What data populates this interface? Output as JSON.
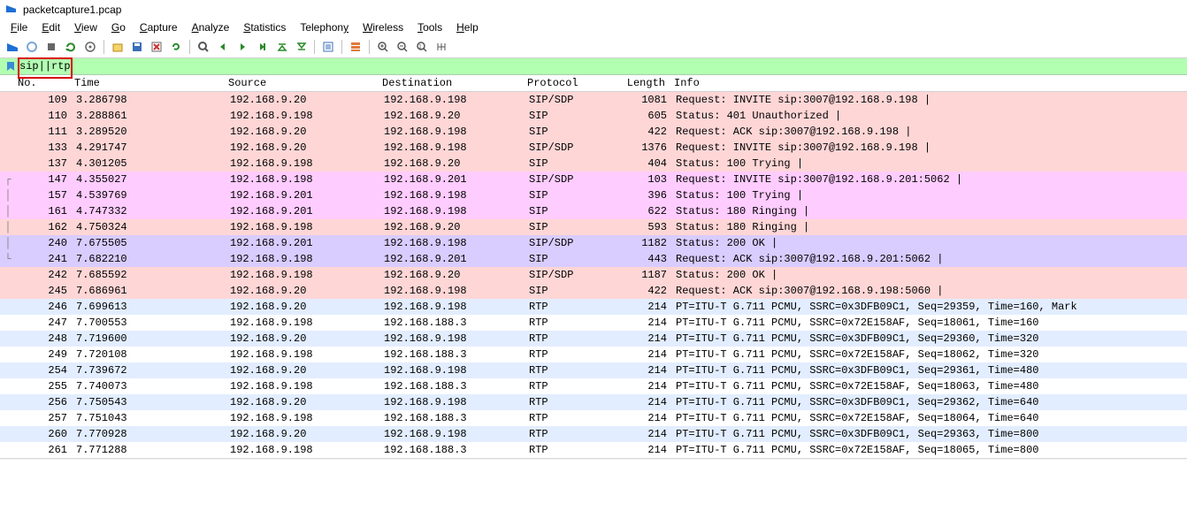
{
  "window": {
    "title": "packetcapture1.pcap"
  },
  "menu": {
    "file": {
      "u": "F",
      "rest": "ile"
    },
    "edit": {
      "u": "E",
      "rest": "dit"
    },
    "view": {
      "u": "V",
      "rest": "iew"
    },
    "go": {
      "u": "G",
      "rest": "o"
    },
    "capture": {
      "u": "C",
      "rest": "apture"
    },
    "analyze": {
      "u": "A",
      "rest": "nalyze"
    },
    "statistics": {
      "u": "S",
      "rest": "tatistics"
    },
    "telephony": {
      "u": "T",
      "rest": "elephony"
    },
    "wireless": {
      "u": "W",
      "rest": "ireless"
    },
    "tools": {
      "u": "T",
      "rest": "ools"
    },
    "help": {
      "u": "H",
      "rest": "elp"
    }
  },
  "filter": {
    "value": "sip||rtp"
  },
  "columns": {
    "no": "No.",
    "time": "Time",
    "src": "Source",
    "dst": "Destination",
    "proto": "Protocol",
    "len": "Length",
    "info": "Info"
  },
  "rows": [
    {
      "no": "109",
      "time": "3.286798",
      "src": "192.168.9.20",
      "dst": "192.168.9.198",
      "proto": "SIP/SDP",
      "len": "1081",
      "info": "Request: INVITE sip:3007@192.168.9.198 | ",
      "cls": "r-pink",
      "g": ""
    },
    {
      "no": "110",
      "time": "3.288861",
      "src": "192.168.9.198",
      "dst": "192.168.9.20",
      "proto": "SIP",
      "len": "605",
      "info": "Status: 401 Unauthorized | ",
      "cls": "r-pink",
      "g": ""
    },
    {
      "no": "111",
      "time": "3.289520",
      "src": "192.168.9.20",
      "dst": "192.168.9.198",
      "proto": "SIP",
      "len": "422",
      "info": "Request: ACK sip:3007@192.168.9.198 | ",
      "cls": "r-pink",
      "g": ""
    },
    {
      "no": "133",
      "time": "4.291747",
      "src": "192.168.9.20",
      "dst": "192.168.9.198",
      "proto": "SIP/SDP",
      "len": "1376",
      "info": "Request: INVITE sip:3007@192.168.9.198 | ",
      "cls": "r-pink",
      "g": ""
    },
    {
      "no": "137",
      "time": "4.301205",
      "src": "192.168.9.198",
      "dst": "192.168.9.20",
      "proto": "SIP",
      "len": "404",
      "info": "Status: 100 Trying | ",
      "cls": "r-pink",
      "g": ""
    },
    {
      "no": "147",
      "time": "4.355027",
      "src": "192.168.9.198",
      "dst": "192.168.9.201",
      "proto": "SIP/SDP",
      "len": "103",
      "info": "Request: INVITE sip:3007@192.168.9.201:5062 | ",
      "cls": "r-magenta",
      "g": "┌"
    },
    {
      "no": "157",
      "time": "4.539769",
      "src": "192.168.9.201",
      "dst": "192.168.9.198",
      "proto": "SIP",
      "len": "396",
      "info": "Status: 100 Trying | ",
      "cls": "r-magenta",
      "g": "│"
    },
    {
      "no": "161",
      "time": "4.747332",
      "src": "192.168.9.201",
      "dst": "192.168.9.198",
      "proto": "SIP",
      "len": "622",
      "info": "Status: 180 Ringing | ",
      "cls": "r-magenta",
      "g": "│"
    },
    {
      "no": "162",
      "time": "4.750324",
      "src": "192.168.9.198",
      "dst": "192.168.9.20",
      "proto": "SIP",
      "len": "593",
      "info": "Status: 180 Ringing | ",
      "cls": "r-pink",
      "g": "│"
    },
    {
      "no": "240",
      "time": "7.675505",
      "src": "192.168.9.201",
      "dst": "192.168.9.198",
      "proto": "SIP/SDP",
      "len": "1182",
      "info": "Status: 200 OK | ",
      "cls": "r-purple",
      "g": "│"
    },
    {
      "no": "241",
      "time": "7.682210",
      "src": "192.168.9.198",
      "dst": "192.168.9.201",
      "proto": "SIP",
      "len": "443",
      "info": "Request: ACK sip:3007@192.168.9.201:5062 | ",
      "cls": "r-purple",
      "g": "└"
    },
    {
      "no": "242",
      "time": "7.685592",
      "src": "192.168.9.198",
      "dst": "192.168.9.20",
      "proto": "SIP/SDP",
      "len": "1187",
      "info": "Status: 200 OK | ",
      "cls": "r-pink",
      "g": ""
    },
    {
      "no": "245",
      "time": "7.686961",
      "src": "192.168.9.20",
      "dst": "192.168.9.198",
      "proto": "SIP",
      "len": "422",
      "info": "Request: ACK sip:3007@192.168.9.198:5060 | ",
      "cls": "r-pink",
      "g": ""
    },
    {
      "no": "246",
      "time": "7.699613",
      "src": "192.168.9.20",
      "dst": "192.168.9.198",
      "proto": "RTP",
      "len": "214",
      "info": "PT=ITU-T G.711 PCMU, SSRC=0x3DFB09C1, Seq=29359, Time=160, Mark",
      "cls": "r-blue",
      "g": ""
    },
    {
      "no": "247",
      "time": "7.700553",
      "src": "192.168.9.198",
      "dst": "192.168.188.3",
      "proto": "RTP",
      "len": "214",
      "info": "PT=ITU-T G.711 PCMU, SSRC=0x72E158AF, Seq=18061, Time=160",
      "cls": "r-white",
      "g": ""
    },
    {
      "no": "248",
      "time": "7.719600",
      "src": "192.168.9.20",
      "dst": "192.168.9.198",
      "proto": "RTP",
      "len": "214",
      "info": "PT=ITU-T G.711 PCMU, SSRC=0x3DFB09C1, Seq=29360, Time=320",
      "cls": "r-blue",
      "g": ""
    },
    {
      "no": "249",
      "time": "7.720108",
      "src": "192.168.9.198",
      "dst": "192.168.188.3",
      "proto": "RTP",
      "len": "214",
      "info": "PT=ITU-T G.711 PCMU, SSRC=0x72E158AF, Seq=18062, Time=320",
      "cls": "r-white",
      "g": ""
    },
    {
      "no": "254",
      "time": "7.739672",
      "src": "192.168.9.20",
      "dst": "192.168.9.198",
      "proto": "RTP",
      "len": "214",
      "info": "PT=ITU-T G.711 PCMU, SSRC=0x3DFB09C1, Seq=29361, Time=480",
      "cls": "r-blue",
      "g": ""
    },
    {
      "no": "255",
      "time": "7.740073",
      "src": "192.168.9.198",
      "dst": "192.168.188.3",
      "proto": "RTP",
      "len": "214",
      "info": "PT=ITU-T G.711 PCMU, SSRC=0x72E158AF, Seq=18063, Time=480",
      "cls": "r-white",
      "g": ""
    },
    {
      "no": "256",
      "time": "7.750543",
      "src": "192.168.9.20",
      "dst": "192.168.9.198",
      "proto": "RTP",
      "len": "214",
      "info": "PT=ITU-T G.711 PCMU, SSRC=0x3DFB09C1, Seq=29362, Time=640",
      "cls": "r-blue",
      "g": ""
    },
    {
      "no": "257",
      "time": "7.751043",
      "src": "192.168.9.198",
      "dst": "192.168.188.3",
      "proto": "RTP",
      "len": "214",
      "info": "PT=ITU-T G.711 PCMU, SSRC=0x72E158AF, Seq=18064, Time=640",
      "cls": "r-white",
      "g": ""
    },
    {
      "no": "260",
      "time": "7.770928",
      "src": "192.168.9.20",
      "dst": "192.168.9.198",
      "proto": "RTP",
      "len": "214",
      "info": "PT=ITU-T G.711 PCMU, SSRC=0x3DFB09C1, Seq=29363, Time=800",
      "cls": "r-blue",
      "g": ""
    },
    {
      "no": "261",
      "time": "7.771288",
      "src": "192.168.9.198",
      "dst": "192.168.188.3",
      "proto": "RTP",
      "len": "214",
      "info": "PT=ITU-T G.711 PCMU, SSRC=0x72E158AF, Seq=18065, Time=800",
      "cls": "r-white",
      "g": ""
    }
  ]
}
